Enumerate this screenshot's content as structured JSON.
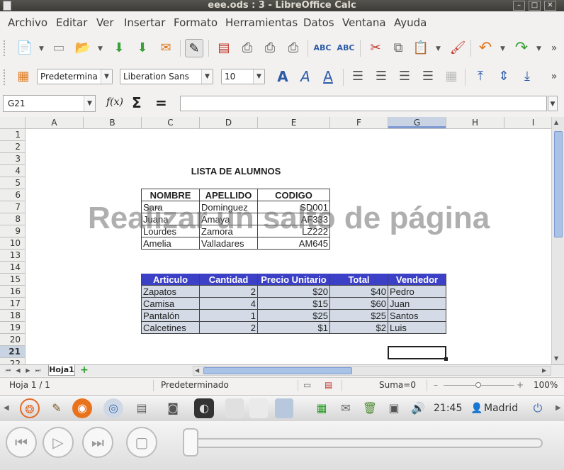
{
  "window": {
    "title": "eee.ods : 3 - LibreOffice Calc",
    "min": "–",
    "max": "□",
    "close": "✕"
  },
  "menu": [
    "Archivo",
    "Editar",
    "Ver",
    "Insertar",
    "Formato",
    "Herramientas",
    "Datos",
    "Ventana",
    "Ayuda"
  ],
  "format_toolbar": {
    "style": "Predetermina",
    "font": "Liberation Sans",
    "size": "10"
  },
  "formula_bar": {
    "cell_ref": "G21",
    "fx": "f(x)",
    "sum": "Σ",
    "equals": "=",
    "formula": ""
  },
  "columns": [
    "A",
    "B",
    "C",
    "D",
    "E",
    "F",
    "G",
    "H",
    "I"
  ],
  "selected_column": "G",
  "rows": [
    "1",
    "2",
    "3",
    "4",
    "5",
    "6",
    "7",
    "8",
    "9",
    "10",
    "13",
    "14",
    "15",
    "16",
    "17",
    "18",
    "19",
    "20",
    "21",
    "22"
  ],
  "selected_row": "21",
  "sheet": {
    "title": "LISTA DE ALUMNOS",
    "students_headers": [
      "NOMBRE",
      "APELLIDO",
      "CODIGO"
    ],
    "students": [
      [
        "Sara",
        "Dominguez",
        "SD001"
      ],
      [
        "Juana",
        "Amaya",
        "AF333"
      ],
      [
        "Lourdes",
        "Zamora",
        "LZ222"
      ],
      [
        "Amelia",
        "Valladares",
        "AM645"
      ]
    ],
    "sales_headers": [
      "Articulo",
      "Cantidad",
      "Precio Unitario",
      "Total",
      "Vendedor"
    ],
    "sales": [
      [
        "Zapatos",
        "2",
        "$20",
        "$40",
        "Pedro"
      ],
      [
        "Camisa",
        "4",
        "$15",
        "$60",
        "Juan"
      ],
      [
        "Pantalón",
        "1",
        "$25",
        "$25",
        "Santos"
      ],
      [
        "Calcetines",
        "2",
        "$1",
        "$2",
        "Luis"
      ]
    ],
    "watermark": "Realizar un salto de página"
  },
  "tabs": {
    "sheet": "Hoja1",
    "add": "+"
  },
  "status": {
    "sheet_of": "Hoja 1 / 1",
    "style": "Predeterminado",
    "sum": "Suma=0",
    "zoom": "100%",
    "zoom_minus": "–",
    "zoom_plus": "+"
  },
  "taskbar": {
    "time": "21:45",
    "location": "Madrid"
  },
  "media": {
    "position_fraction": 0.0
  }
}
